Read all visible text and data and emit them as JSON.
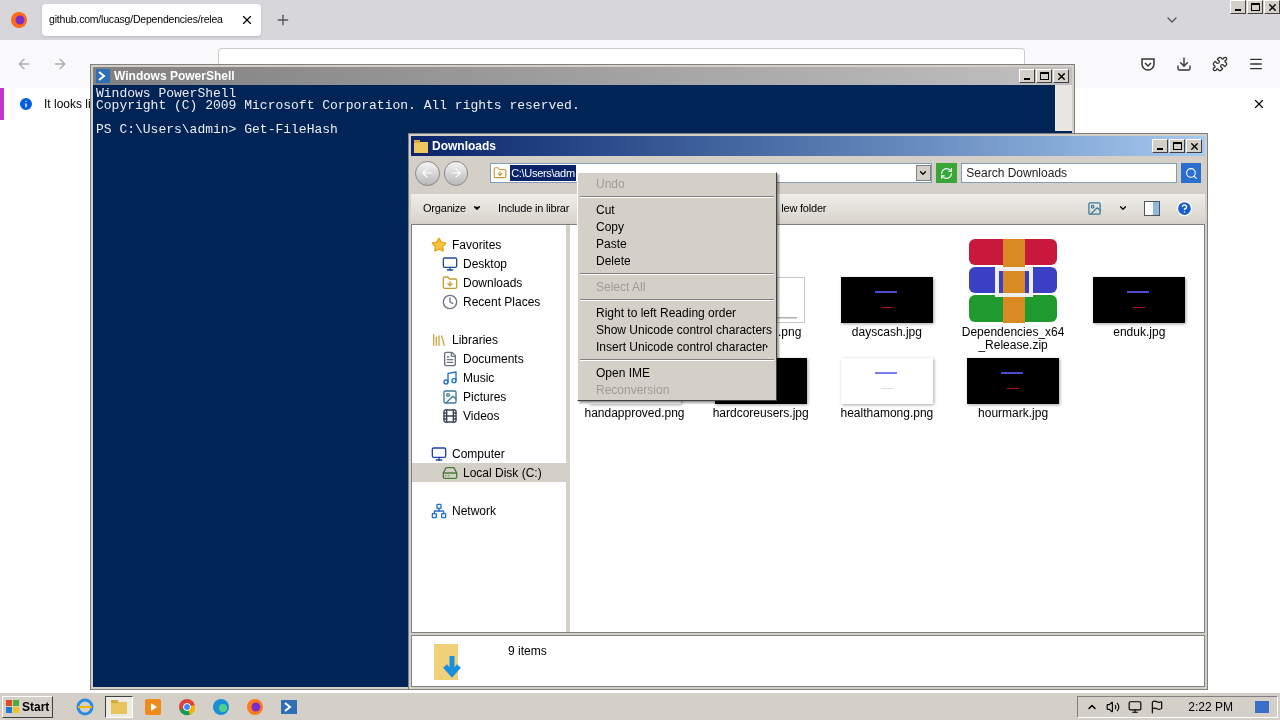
{
  "browser": {
    "tab_title": "github.com/lucasg/Dependencies/relea",
    "notification": "It looks li"
  },
  "powershell": {
    "title": "Windows PowerShell",
    "lines": [
      "Windows PowerShell",
      "Copyright (C) 2009 Microsoft Corporation. All rights reserved."
    ],
    "prompt": "PS C:\\Users\\admin> Get-FileHash"
  },
  "explorer": {
    "title": "Downloads",
    "address": "C:\\Users\\adm",
    "search": {
      "placeholder": "Search Downloads"
    },
    "toolbar": [
      {
        "label": "Organize",
        "dropdown": true
      },
      {
        "label": "Include in librar",
        "dropdown": false
      },
      {
        "label": "lew folder",
        "dropdown": false
      }
    ],
    "sidebar": [
      {
        "label": "Favorites",
        "kind": "favorites",
        "children": [
          {
            "label": "Desktop",
            "kind": "desktop",
            "selected": false
          },
          {
            "label": "Downloads",
            "kind": "downloads",
            "selected": false
          },
          {
            "label": "Recent Places",
            "kind": "recent",
            "selected": false
          }
        ]
      },
      {
        "label": "Libraries",
        "kind": "libraries",
        "children": [
          {
            "label": "Documents",
            "kind": "documents",
            "selected": false
          },
          {
            "label": "Music",
            "kind": "music",
            "selected": false
          },
          {
            "label": "Pictures",
            "kind": "pictures",
            "selected": false
          },
          {
            "label": "Videos",
            "kind": "videos",
            "selected": false
          }
        ]
      },
      {
        "label": "Computer",
        "kind": "computer",
        "children": [
          {
            "label": "Local Disk (C:)",
            "kind": "disk",
            "selected": true
          }
        ]
      },
      {
        "label": "Network",
        "kind": "network"
      }
    ],
    "files": [
      {
        "name": ".png",
        "kind": "cropped"
      },
      {
        "name": "dayscash.jpg",
        "kind": "dark"
      },
      {
        "name": "Dependencies_x64 _Release.zip",
        "kind": "archive"
      },
      {
        "name": "enduk.jpg",
        "kind": "dark"
      },
      {
        "name": "handapproved.png",
        "kind": "light"
      },
      {
        "name": "hardcoreusers.jpg",
        "kind": "dark"
      },
      {
        "name": "healthamong.png",
        "kind": "light"
      },
      {
        "name": "hourmark.jpg",
        "kind": "dark"
      }
    ],
    "details": "9 items"
  },
  "context_menu": [
    {
      "kind": "item",
      "label": "Undo",
      "disabled": true
    },
    {
      "kind": "separator"
    },
    {
      "kind": "item",
      "label": "Cut",
      "disabled": false
    },
    {
      "kind": "item",
      "label": "Copy",
      "disabled": false
    },
    {
      "kind": "item",
      "label": "Paste",
      "disabled": false
    },
    {
      "kind": "item",
      "label": "Delete",
      "disabled": false
    },
    {
      "kind": "separator"
    },
    {
      "kind": "item",
      "label": "Select All",
      "disabled": true
    },
    {
      "kind": "separator"
    },
    {
      "kind": "item",
      "label": "Right to left Reading order",
      "disabled": false
    },
    {
      "kind": "item",
      "label": "Show Unicode control characters",
      "disabled": false
    },
    {
      "kind": "submenu",
      "label": "Insert Unicode control character",
      "disabled": false
    },
    {
      "kind": "separator"
    },
    {
      "kind": "item",
      "label": "Open IME",
      "disabled": false
    },
    {
      "kind": "item",
      "label": "Reconversion",
      "disabled": true
    }
  ],
  "taskbar": {
    "start": "Start",
    "apps": [
      {
        "kind": "ie",
        "selected": false
      },
      {
        "kind": "explorer",
        "selected": true
      },
      {
        "kind": "media",
        "selected": false
      },
      {
        "kind": "chrome",
        "selected": false
      },
      {
        "kind": "edge",
        "selected": false
      },
      {
        "kind": "firefox",
        "selected": false
      },
      {
        "kind": "powershell",
        "selected": false
      }
    ],
    "clock": "2:22 PM"
  }
}
